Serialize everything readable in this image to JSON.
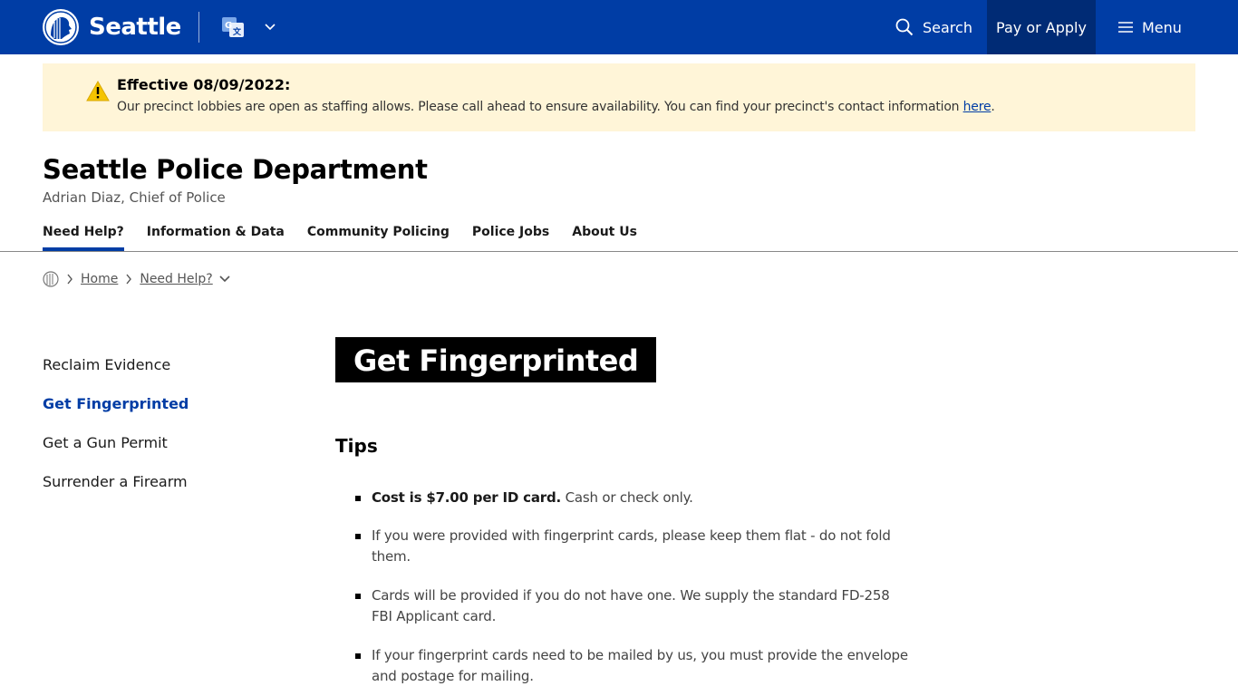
{
  "header": {
    "brand": "Seattle",
    "search_label": "Search",
    "pay_label": "Pay or Apply",
    "menu_label": "Menu",
    "brand_color": "#003da5"
  },
  "alert": {
    "title": "Effective 08/09/2022:",
    "body": "Our precinct lobbies are open as staffing allows. Please call ahead to ensure availability. You can find your precinct's contact information ",
    "link_text": "here",
    "trail": "."
  },
  "department": {
    "title": "Seattle Police Department",
    "subtitle": "Adrian Diaz, Chief of Police"
  },
  "dept_nav": {
    "items": [
      {
        "label": "Need Help?",
        "active": true
      },
      {
        "label": "Information & Data",
        "active": false
      },
      {
        "label": "Community Policing",
        "active": false
      },
      {
        "label": "Police Jobs",
        "active": false
      },
      {
        "label": "About Us",
        "active": false
      }
    ]
  },
  "breadcrumb": {
    "home": "Home",
    "current": "Need Help?"
  },
  "side_nav": {
    "items": [
      {
        "label": "Reclaim Evidence",
        "active": false
      },
      {
        "label": "Get Fingerprinted",
        "active": true
      },
      {
        "label": "Get a Gun Permit",
        "active": false
      },
      {
        "label": "Surrender a Firearm",
        "active": false
      }
    ]
  },
  "main": {
    "title": "Get Fingerprinted",
    "tips_heading": "Tips",
    "tips": [
      {
        "bold": "Cost is $7.00 per ID card.",
        "text": " Cash or check only."
      },
      {
        "bold": "",
        "text": "If you were provided with fingerprint cards, please keep them flat - do not fold them."
      },
      {
        "bold": "",
        "text": "Cards will be provided if you do not have one.  We supply the standard FD-258 FBI Applicant card."
      },
      {
        "bold": "",
        "text": "If your fingerprint cards need to be mailed by us, you must provide the envelope and postage for mailing."
      }
    ]
  }
}
